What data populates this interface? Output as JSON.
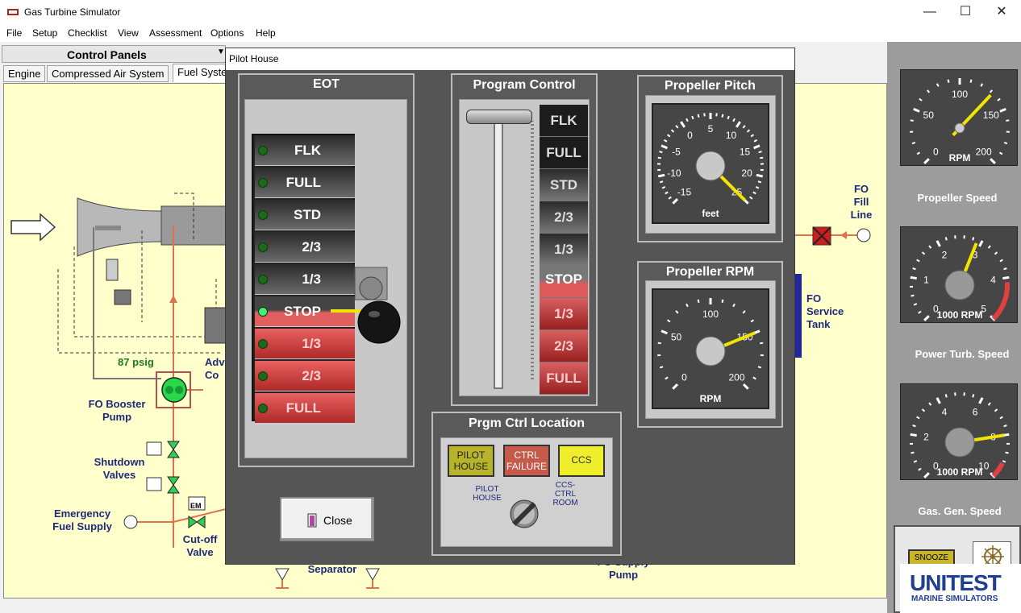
{
  "window": {
    "title": "Gas Turbine Simulator",
    "minimize": "—",
    "maximize": "☐",
    "close": "✕"
  },
  "menu": [
    "File",
    "Setup",
    "Checklist",
    "View",
    "Assessment",
    "Options",
    "Help"
  ],
  "control_panels": {
    "label": "Control Panels"
  },
  "tabs": [
    "Engine",
    "Compressed Air System",
    "Fuel Syste"
  ],
  "diagram": {
    "psig": "87 psig",
    "fo_booster_pump": "FO Booster\nPump",
    "shutdown_valves": "Shutdown\nValves",
    "emergency_fuel_supply": "Emergency\nFuel Supply",
    "cutoff_valve": "Cut-off\nValve",
    "separator": "Separator",
    "fo_supply_pump": "FO Supply\nPump",
    "fo_fill_line": "FO\nFill\nLine",
    "fo_service_tank": "FO\nService\nTank",
    "adv_partial": "Adv\nCo",
    "em": "EM"
  },
  "right_gauges": [
    {
      "label": "Propeller Speed",
      "unit": "RPM",
      "ticks": [
        "0",
        "50",
        "100",
        "150",
        "200"
      ],
      "value_fraction": 0.66
    },
    {
      "label": "Power Turb. Speed",
      "unit": "1000  RPM",
      "ticks": [
        "0",
        "1",
        "2",
        "3",
        "4",
        "5"
      ],
      "value_fraction": 0.58
    },
    {
      "label": "Gas. Gen. Speed",
      "unit": "1000  RPM",
      "ticks": [
        "0",
        "2",
        "4",
        "6",
        "8",
        "10"
      ],
      "value_fraction": 0.8
    }
  ],
  "dialog": {
    "title": "Pilot House",
    "eot": {
      "title": "EOT",
      "rows": [
        "FLK",
        "FULL",
        "STD",
        "2/3",
        "1/3",
        "STOP",
        "1/3",
        "2/3",
        "FULL"
      ],
      "active": "STOP"
    },
    "program_control": {
      "title": "Program Control",
      "rows": [
        "FLK",
        "FULL",
        "STD",
        "2/3",
        "1/3",
        "STOP",
        "1/3",
        "2/3",
        "FULL"
      ]
    },
    "propeller_pitch": {
      "title": "Propeller Pitch",
      "unit": "feet",
      "ticks": [
        "-15",
        "-10",
        "-5",
        "0",
        "5",
        "10",
        "15",
        "20",
        "25"
      ],
      "value": 25
    },
    "propeller_rpm": {
      "title": "Propeller RPM",
      "unit": "RPM",
      "ticks": [
        "0",
        "50",
        "100",
        "150",
        "200"
      ],
      "value": 150
    },
    "prgm_ctrl_location": {
      "title": "Prgm Ctrl Location",
      "buttons": [
        "PILOT\nHOUSE",
        "CTRL\nFAILURE",
        "CCS"
      ],
      "switch_left": "PILOT\nHOUSE",
      "switch_right": "CCS-\nCTRL\nROOM"
    },
    "close_label": "Close"
  },
  "bottom_right": {
    "snooze": "SNOOZE"
  },
  "logo": {
    "name": "UNITEST",
    "sub": "MARINE SIMULATORS"
  },
  "colors": {
    "panel_gray": "#555555",
    "led_green": "#1b6b1b",
    "led_active": "#44ee77",
    "ahead_red": "#c43a3a",
    "needle_yellow": "#f2e600",
    "diagram_blue": "#1e2a78"
  }
}
